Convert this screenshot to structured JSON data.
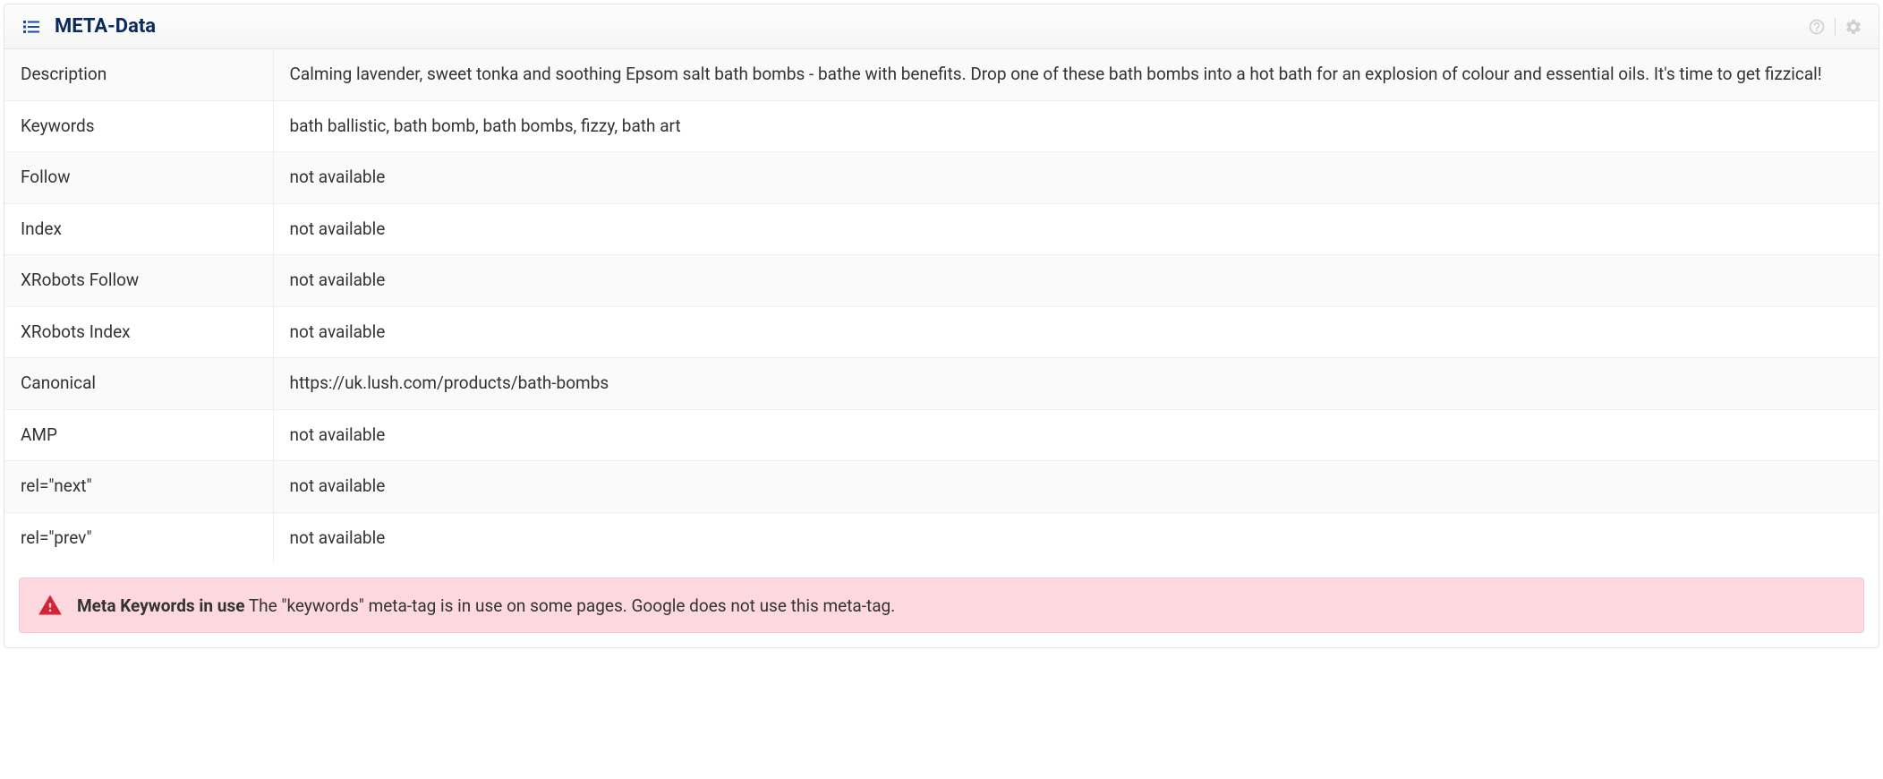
{
  "panel": {
    "title": "META-Data"
  },
  "rows": [
    {
      "label": "Description",
      "value": "Calming lavender, sweet tonka and soothing Epsom salt bath bombs - bathe with benefits. Drop one of these bath bombs into a hot bath for an explosion of colour and essential oils. It's time to get fizzical!"
    },
    {
      "label": "Keywords",
      "value": "bath ballistic, bath bomb, bath bombs, fizzy, bath art"
    },
    {
      "label": "Follow",
      "value": "not available"
    },
    {
      "label": "Index",
      "value": "not available"
    },
    {
      "label": "XRobots Follow",
      "value": "not available"
    },
    {
      "label": "XRobots Index",
      "value": "not available"
    },
    {
      "label": "Canonical",
      "value": "https://uk.lush.com/products/bath-bombs"
    },
    {
      "label": "AMP",
      "value": "not available"
    },
    {
      "label": "rel=\"next\"",
      "value": "not available"
    },
    {
      "label": "rel=\"prev\"",
      "value": "not available"
    }
  ],
  "alert": {
    "title": "Meta Keywords in use",
    "text": "The \"keywords\" meta-tag is in use on some pages. Google does not use this meta-tag."
  }
}
